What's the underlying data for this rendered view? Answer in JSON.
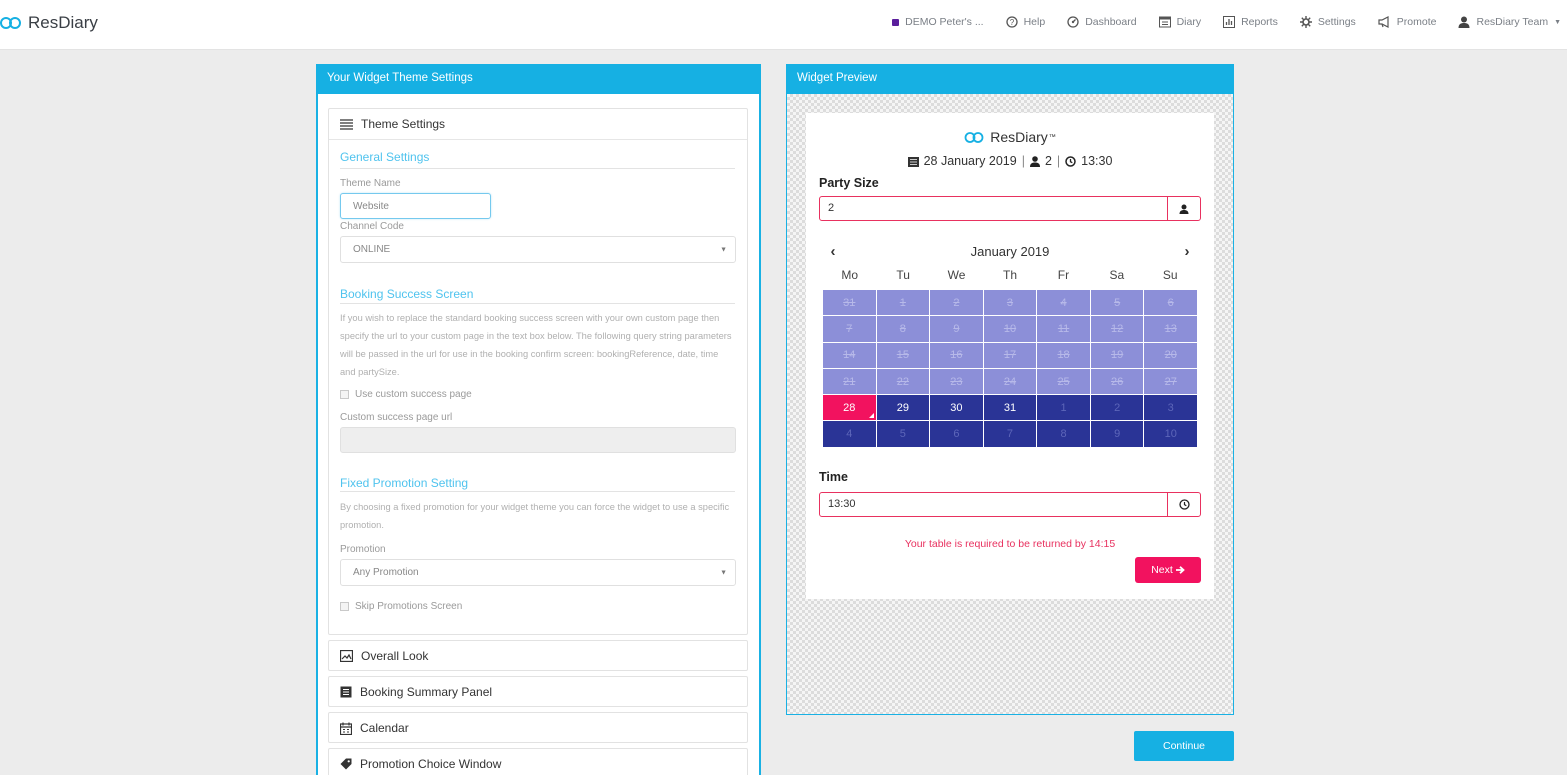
{
  "header": {
    "brand": "ResDiary",
    "nav": [
      {
        "label": "DEMO Peter's ...",
        "icon": "square-dot-icon"
      },
      {
        "label": "Help",
        "icon": "help-circle-icon"
      },
      {
        "label": "Dashboard",
        "icon": "dashboard-icon"
      },
      {
        "label": "Diary",
        "icon": "diary-icon"
      },
      {
        "label": "Reports",
        "icon": "reports-icon"
      },
      {
        "label": "Settings",
        "icon": "gear-icon"
      },
      {
        "label": "Promote",
        "icon": "megaphone-icon"
      },
      {
        "label": "ResDiary Team",
        "icon": "user-icon"
      }
    ],
    "accent_dot_color": "#5a1e9c"
  },
  "left_panel": {
    "title": "Your Widget Theme Settings",
    "theme_settings": {
      "title": "Theme Settings",
      "general": {
        "title": "General Settings",
        "theme_name_label": "Theme Name",
        "theme_name_value": "Website",
        "channel_code_label": "Channel Code",
        "channel_code_value": "ONLINE"
      },
      "success": {
        "title": "Booking Success Screen",
        "description": "If you wish to replace the standard booking success screen with your own custom page then specify the url to your custom page in the text box below. The following query string parameters will be passed in the url for use in the booking confirm screen: bookingReference, date, time and partySize.",
        "use_custom_label": "Use custom success page",
        "custom_url_label": "Custom success page url",
        "custom_url_value": ""
      },
      "promotion": {
        "title": "Fixed Promotion Setting",
        "description": "By choosing a fixed promotion for your widget theme you can force the widget to use a specific promotion.",
        "promotion_label": "Promotion",
        "promotion_value": "Any Promotion",
        "skip_label": "Skip Promotions Screen"
      }
    },
    "sections": [
      {
        "title": "Overall Look",
        "icon": "image-icon"
      },
      {
        "title": "Booking Summary Panel",
        "icon": "panel-icon"
      },
      {
        "title": "Calendar",
        "icon": "calendar-icon"
      },
      {
        "title": "Promotion Choice Window",
        "icon": "tag-icon"
      }
    ]
  },
  "preview": {
    "title": "Widget Preview",
    "logo_text": "ResDiary",
    "trademark": "™",
    "summary": {
      "date": "28 January 2019",
      "party": "2",
      "time": "13:30",
      "sep": "|"
    },
    "party_size_label": "Party Size",
    "party_size_value": "2",
    "calendar": {
      "month": "January 2019",
      "prev": "‹",
      "next": "›",
      "weekdays": [
        "Mo",
        "Tu",
        "We",
        "Th",
        "Fr",
        "Sa",
        "Su"
      ],
      "weeks": [
        [
          {
            "d": "31",
            "s": "past"
          },
          {
            "d": "1",
            "s": "past"
          },
          {
            "d": "2",
            "s": "past"
          },
          {
            "d": "3",
            "s": "past"
          },
          {
            "d": "4",
            "s": "past"
          },
          {
            "d": "5",
            "s": "past"
          },
          {
            "d": "6",
            "s": "past"
          }
        ],
        [
          {
            "d": "7",
            "s": "past"
          },
          {
            "d": "8",
            "s": "past"
          },
          {
            "d": "9",
            "s": "past"
          },
          {
            "d": "10",
            "s": "past"
          },
          {
            "d": "11",
            "s": "past"
          },
          {
            "d": "12",
            "s": "past"
          },
          {
            "d": "13",
            "s": "past"
          }
        ],
        [
          {
            "d": "14",
            "s": "past"
          },
          {
            "d": "15",
            "s": "past"
          },
          {
            "d": "16",
            "s": "past"
          },
          {
            "d": "17",
            "s": "past"
          },
          {
            "d": "18",
            "s": "past"
          },
          {
            "d": "19",
            "s": "past"
          },
          {
            "d": "20",
            "s": "past"
          }
        ],
        [
          {
            "d": "21",
            "s": "past"
          },
          {
            "d": "22",
            "s": "past"
          },
          {
            "d": "23",
            "s": "past"
          },
          {
            "d": "24",
            "s": "past"
          },
          {
            "d": "25",
            "s": "past"
          },
          {
            "d": "26",
            "s": "past"
          },
          {
            "d": "27",
            "s": "past"
          }
        ],
        [
          {
            "d": "28",
            "s": "sel"
          },
          {
            "d": "29",
            "s": "avail"
          },
          {
            "d": "30",
            "s": "avail"
          },
          {
            "d": "31",
            "s": "avail"
          },
          {
            "d": "1",
            "s": "other"
          },
          {
            "d": "2",
            "s": "other"
          },
          {
            "d": "3",
            "s": "other"
          }
        ],
        [
          {
            "d": "4",
            "s": "other"
          },
          {
            "d": "5",
            "s": "other"
          },
          {
            "d": "6",
            "s": "other"
          },
          {
            "d": "7",
            "s": "other"
          },
          {
            "d": "8",
            "s": "other"
          },
          {
            "d": "9",
            "s": "other"
          },
          {
            "d": "10",
            "s": "other"
          }
        ]
      ]
    },
    "time_label": "Time",
    "time_value": "13:30",
    "return_note": "Your table is required to be returned by 14:15",
    "next_label": "Next",
    "colors": {
      "accent": "#f2125f",
      "calendar": "#2a3496",
      "calendar_past": "#8c8fd8"
    }
  },
  "continue_label": "Continue",
  "brand_color": "#16b0e3"
}
